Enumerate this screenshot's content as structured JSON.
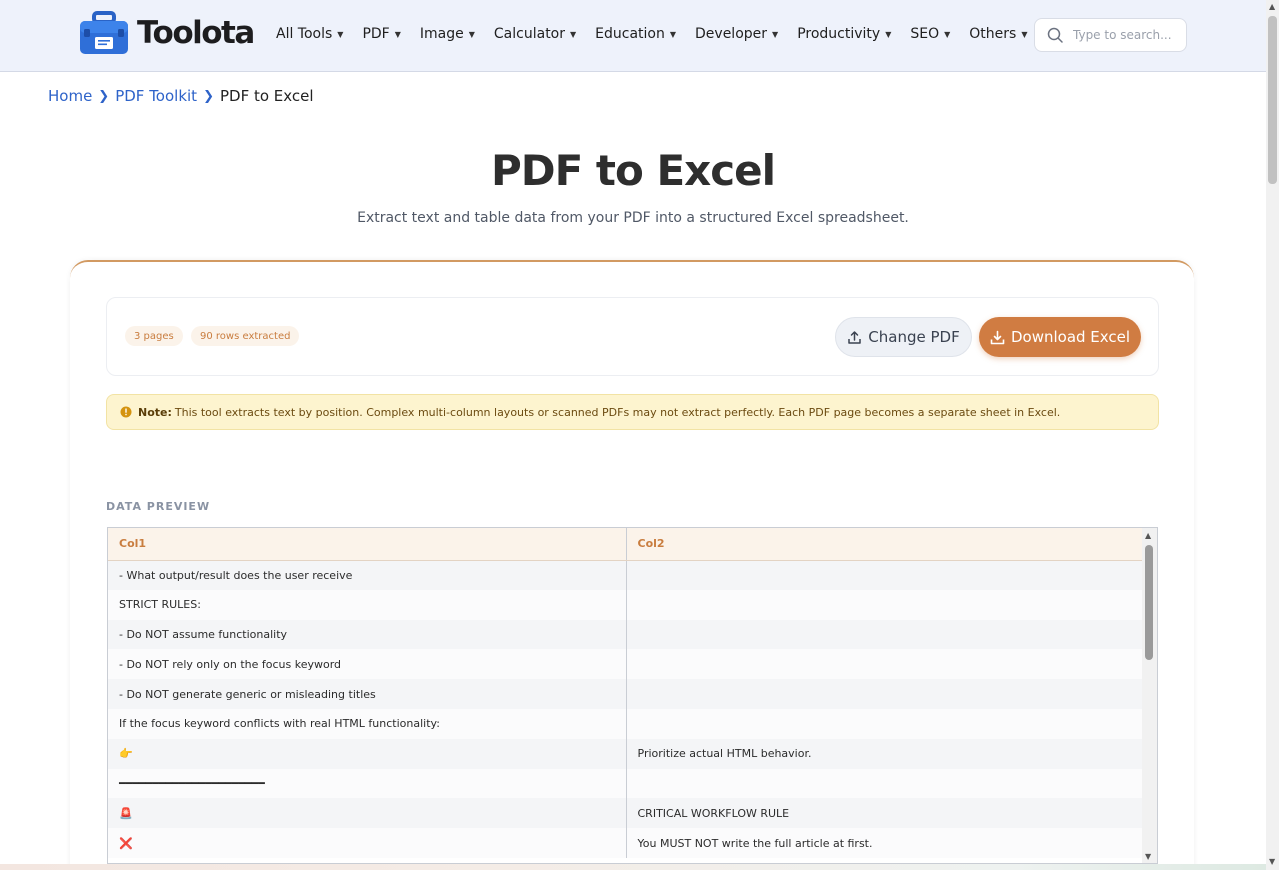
{
  "brand": {
    "name": "Toolota"
  },
  "nav": {
    "items": [
      {
        "label": "All Tools"
      },
      {
        "label": "PDF"
      },
      {
        "label": "Image"
      },
      {
        "label": "Calculator"
      },
      {
        "label": "Education"
      },
      {
        "label": "Developer"
      },
      {
        "label": "Productivity"
      },
      {
        "label": "SEO"
      },
      {
        "label": "Others"
      }
    ]
  },
  "search": {
    "placeholder": "Type to search..."
  },
  "breadcrumb": {
    "home": "Home",
    "section": "PDF Toolkit",
    "current": "PDF to Excel"
  },
  "hero": {
    "title": "PDF to Excel",
    "subtitle": "Extract text and table data from your PDF into a structured Excel spreadsheet."
  },
  "toolbar": {
    "pages_chip": "3 pages",
    "rows_chip": "90 rows extracted",
    "change_label": "Change PDF",
    "download_label": "Download Excel"
  },
  "note": {
    "label": "Note:",
    "text": "This tool extracts text by position. Complex multi-column layouts or scanned PDFs may not extract perfectly. Each PDF page becomes a separate sheet in Excel."
  },
  "preview": {
    "label": "DATA PREVIEW",
    "columns": [
      "Col1",
      "Col2"
    ],
    "rows": [
      [
        "- What output/result does the user receive",
        ""
      ],
      [
        "STRICT RULES:",
        ""
      ],
      [
        "- Do NOT assume functionality",
        ""
      ],
      [
        "- Do NOT rely only on the focus keyword",
        ""
      ],
      [
        "- Do NOT generate generic or misleading titles",
        ""
      ],
      [
        "If the focus keyword conflicts with real HTML functionality:",
        ""
      ],
      [
        "👉",
        "Prioritize actual HTML behavior."
      ],
      [
        "━━━━━━━━━━━━━━━━━━━━━━",
        ""
      ],
      [
        "🚨",
        "CRITICAL WORKFLOW RULE"
      ],
      [
        "❌",
        "You MUST NOT write the full article at first."
      ]
    ]
  },
  "colors": {
    "accent": "#d07c42",
    "link": "#2e63c9",
    "note_bg": "#fdf4cf"
  }
}
